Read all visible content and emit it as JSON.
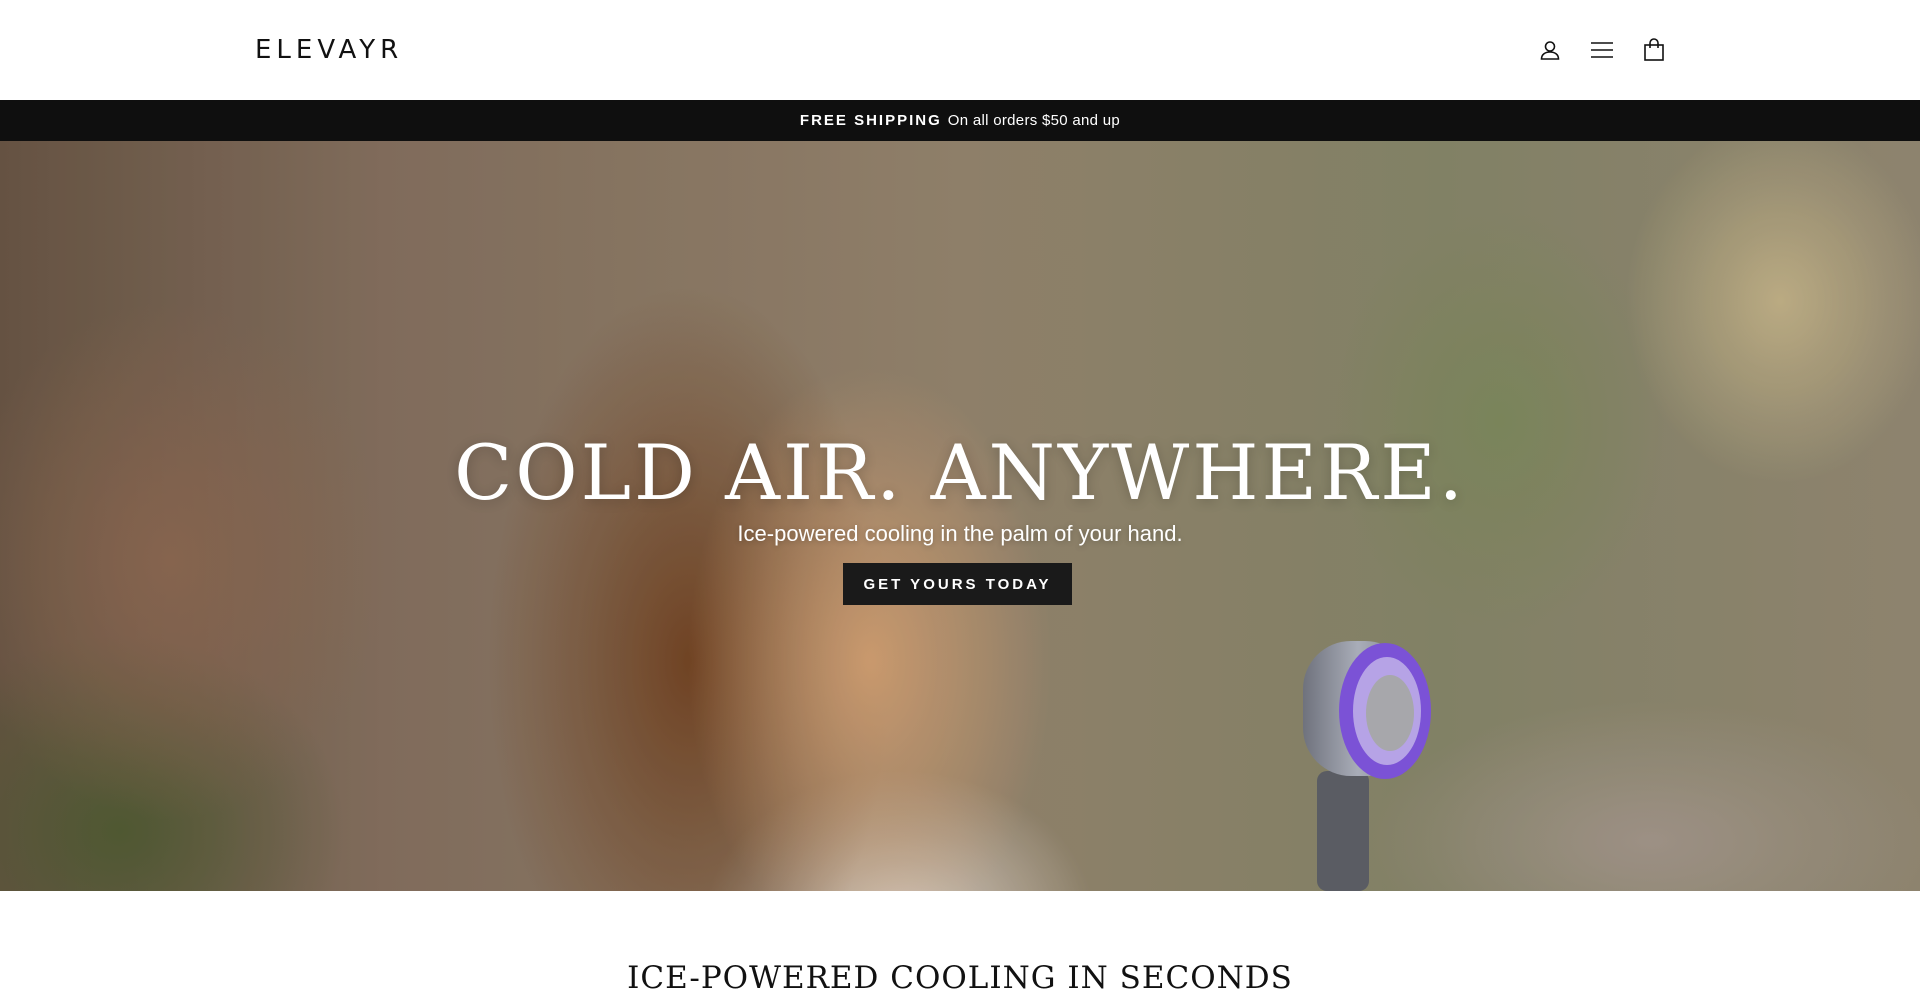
{
  "header": {
    "logo_text": "ELEVAYR",
    "icons": [
      "user-icon",
      "menu-icon",
      "cart-icon"
    ]
  },
  "announcement": {
    "bold_text": "FREE SHIPPING",
    "text": "On all orders $50 and up"
  },
  "hero": {
    "title": "COLD AIR. ANYWHERE.",
    "subtitle": "Ice-powered cooling in the palm of your hand.",
    "cta_label": "GET YOURS TODAY"
  },
  "section": {
    "heading": "ICE-POWERED COOLING IN SECONDS"
  },
  "colors": {
    "announcement_bg": "#0f0f0f",
    "cta_bg": "#1a1a1a",
    "fan_accent": "#7b52d6"
  }
}
